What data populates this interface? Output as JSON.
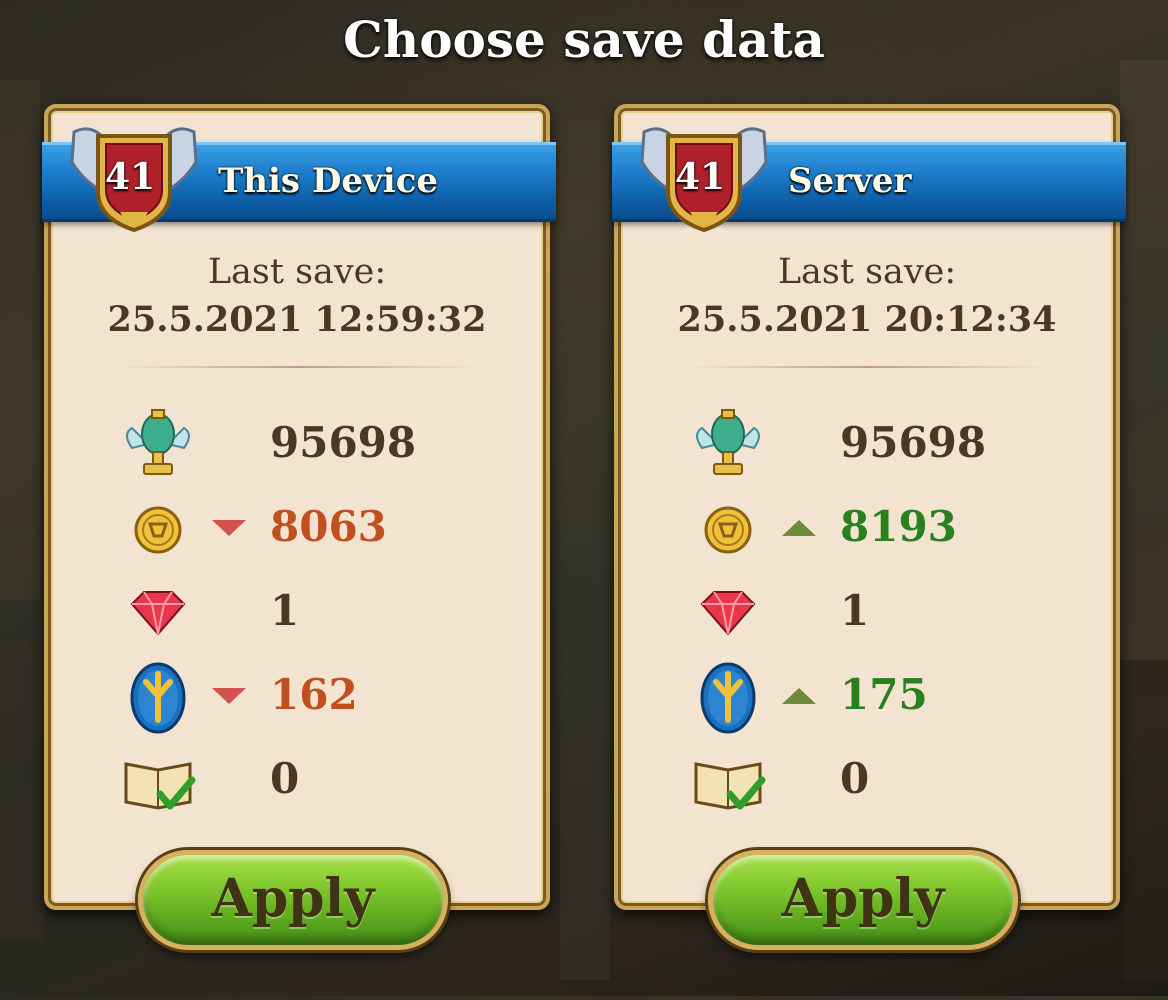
{
  "title": "Choose save data",
  "cards": {
    "left": {
      "source": "This Device",
      "level": "41",
      "last_save_label": "Last save:",
      "last_save_time": "25.5.2021 12:59:32",
      "stats": [
        {
          "icon": "trophy-icon",
          "value": "95698",
          "trend": "none"
        },
        {
          "icon": "gold-coin-icon",
          "value": "8063",
          "trend": "down"
        },
        {
          "icon": "ruby-gem-icon",
          "value": "1",
          "trend": "none"
        },
        {
          "icon": "rune-stone-icon",
          "value": "162",
          "trend": "down"
        },
        {
          "icon": "quest-book-icon",
          "value": "0",
          "trend": "none"
        }
      ],
      "apply_label": "Apply"
    },
    "right": {
      "source": "Server",
      "level": "41",
      "last_save_label": "Last save:",
      "last_save_time": "25.5.2021 20:12:34",
      "stats": [
        {
          "icon": "trophy-icon",
          "value": "95698",
          "trend": "none"
        },
        {
          "icon": "gold-coin-icon",
          "value": "8193",
          "trend": "up"
        },
        {
          "icon": "ruby-gem-icon",
          "value": "1",
          "trend": "none"
        },
        {
          "icon": "rune-stone-icon",
          "value": "175",
          "trend": "up"
        },
        {
          "icon": "quest-book-icon",
          "value": "0",
          "trend": "none"
        }
      ],
      "apply_label": "Apply"
    }
  },
  "colors": {
    "panel": "#f2e4d1",
    "ribbon": "#1d7fcd",
    "decrease": "#c0501f",
    "increase": "#2a7f1e",
    "apply_button": "#7cc42a"
  }
}
